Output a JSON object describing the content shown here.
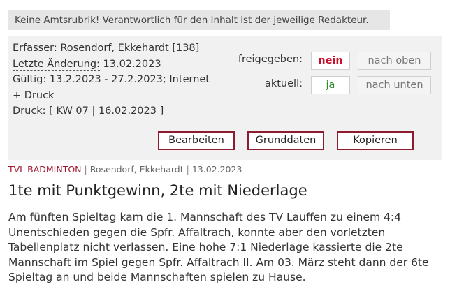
{
  "notice": "Keine Amtsrubrik! Verantwortlich für den Inhalt ist der jeweilige Redakteur.",
  "meta": {
    "author_label": "Erfasser:",
    "author_value": " Rosendorf, Ekkehardt [138]",
    "changed_label": "Letzte Änderung:",
    "changed_value": " 13.02.2023",
    "valid_label": "Gültig:",
    "valid_value": " 13.2.2023 - 27.2.2023; Internet + Druck",
    "print_label": "Druck:",
    "print_value": " [ KW 07 | 16.02.2023 ]"
  },
  "status": {
    "released_label": "freigegeben:",
    "released_value": "nein",
    "current_label": "aktuell:",
    "current_value": "ja",
    "move_up": "nach oben",
    "move_down": "nach unten"
  },
  "actions": {
    "edit": "Bearbeiten",
    "basedata": "Grunddaten",
    "copy": "Kopieren"
  },
  "article": {
    "category": "TVL Badminton",
    "separator": "|",
    "author": "Rosendorf, Ekkehardt",
    "date": "13.02.2023",
    "title": "1te mit Punktgewinn, 2te mit Niederlage",
    "body": "Am fünften Spieltag kam die 1. Mannschaft des TV Lauffen zu einem 4:4 Unentschieden gegen die Spfr. Affaltrach, konnte aber den vorletzten Tabellenplatz nicht verlassen. Eine hohe 7:1 Niederlage kassierte die 2te Mannschaft im Spiel gegen Spfr. Affaltrach II. Am 03. März steht dann der 6te Spieltag an und beide Mannschaften spielen zu Hause."
  },
  "colors": {
    "accent": "#a3162f",
    "no": "#c8102e",
    "yes": "#2e8b2e",
    "panel": "#f1f1f1"
  }
}
